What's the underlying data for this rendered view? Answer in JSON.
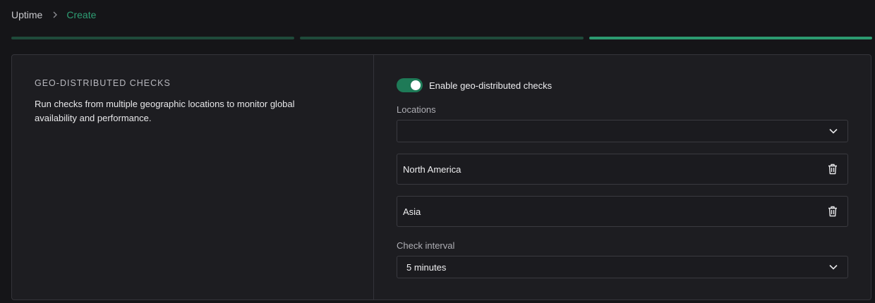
{
  "breadcrumb": {
    "parent": "Uptime",
    "current": "Create"
  },
  "progress": {
    "steps": 3,
    "active_step": 3
  },
  "section": {
    "title": "GEO-DISTRIBUTED CHECKS",
    "description": "Run checks from multiple geographic locations to monitor global availability and performance."
  },
  "geo_toggle": {
    "label": "Enable geo-distributed checks",
    "enabled": true
  },
  "locations": {
    "label": "Locations",
    "select_value": "",
    "items": [
      {
        "name": "North America"
      },
      {
        "name": "Asia"
      }
    ]
  },
  "check_interval": {
    "label": "Check interval",
    "value": "5 minutes"
  },
  "colors": {
    "accent": "#2c9a70",
    "background": "#151518",
    "card": "#1d1d21"
  },
  "icons": {
    "separator": "chevron-right-icon",
    "dropdown": "chevron-down-icon",
    "remove": "trash-icon"
  }
}
